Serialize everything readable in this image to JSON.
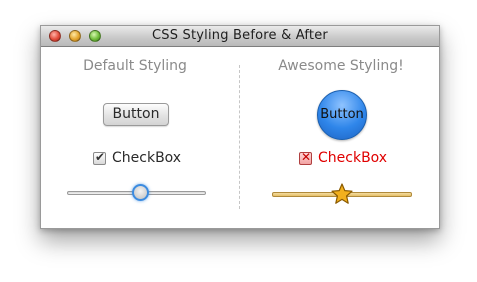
{
  "window": {
    "title": "CSS Styling Before & After"
  },
  "left": {
    "heading": "Default Styling",
    "button_label": "Button",
    "checkbox_label": "CheckBox",
    "checkbox_checked": true,
    "slider_value": 0.55
  },
  "right": {
    "heading": "Awesome Styling!",
    "button_label": "Button",
    "checkbox_label": "CheckBox",
    "checkbox_checked": true,
    "slider_value": 0.5
  },
  "colors": {
    "accent_blue": "#2f86ea",
    "checkbox_red": "#e00000",
    "slider_gold": "#e6c068"
  }
}
